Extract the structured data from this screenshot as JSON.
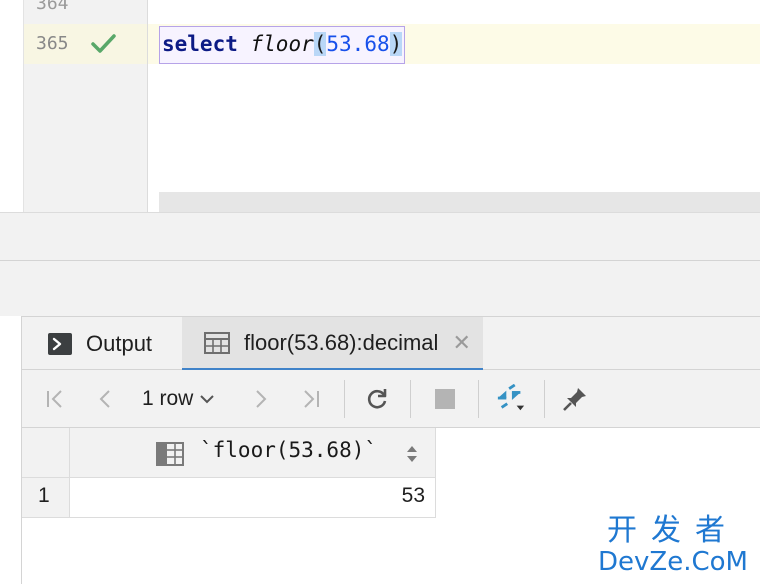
{
  "editor": {
    "prev_line_number": "364",
    "current_line_number": "365",
    "code": {
      "keyword": "select",
      "function": "floor",
      "open_paren": "(",
      "argument": "53.68",
      "close_paren": ")"
    }
  },
  "results": {
    "tabs": [
      {
        "label": "Output",
        "icon": "console-icon"
      },
      {
        "label": "floor(53.68):decimal",
        "icon": "table-icon",
        "active": true
      }
    ],
    "toolbar": {
      "rows_label": "1 row"
    },
    "grid": {
      "columns": [
        "`floor(53.68)`"
      ],
      "rows": [
        {
          "num": "1",
          "values": [
            "53"
          ]
        }
      ]
    }
  },
  "watermark": {
    "cn": "开发者",
    "en": "DevZe.CoM"
  },
  "colors": {
    "keyword": "#0c1a85",
    "number": "#1750eb",
    "accent": "#4083c9",
    "check": "#59a869",
    "watermark": "#1f78d1"
  }
}
